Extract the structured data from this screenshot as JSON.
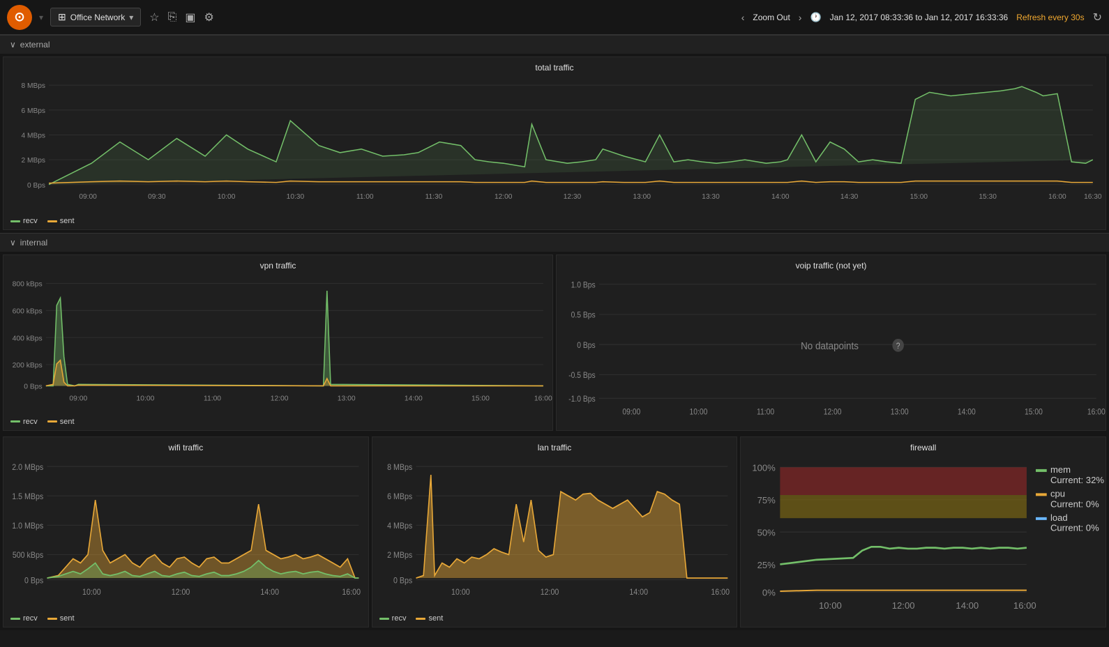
{
  "topnav": {
    "logo": "⊙",
    "title": "Office Network",
    "dropdown_arrow": "▾",
    "icons": [
      "☆",
      "⎘",
      "▣",
      "⚙"
    ],
    "zoom_out": "Zoom Out",
    "time_range": "Jan 12, 2017 08:33:36 to Jan 12, 2017 16:33:36",
    "refresh_label": "Refresh every 30s",
    "refresh_icon": "↻"
  },
  "sections": {
    "external": {
      "label": "external",
      "collapsed": false
    },
    "internal": {
      "label": "internal",
      "collapsed": false
    }
  },
  "panels": {
    "total_traffic": {
      "title": "total traffic",
      "y_labels": [
        "8 MBps",
        "6 MBps",
        "4 MBps",
        "2 MBps",
        "0 Bps"
      ],
      "x_labels": [
        "09:00",
        "09:30",
        "10:00",
        "10:30",
        "11:00",
        "11:30",
        "12:00",
        "12:30",
        "13:00",
        "13:30",
        "14:00",
        "14:30",
        "15:00",
        "15:30",
        "16:00",
        "16:30"
      ],
      "legend": [
        {
          "label": "recv",
          "color": "#73bf69"
        },
        {
          "label": "sent",
          "color": "#e8a838"
        }
      ]
    },
    "vpn_traffic": {
      "title": "vpn traffic",
      "y_labels": [
        "800 kBps",
        "600 kBps",
        "400 kBps",
        "200 kBps",
        "0 Bps"
      ],
      "x_labels": [
        "09:00",
        "10:00",
        "11:00",
        "12:00",
        "13:00",
        "14:00",
        "15:00",
        "16:00"
      ],
      "legend": [
        {
          "label": "recv",
          "color": "#73bf69"
        },
        {
          "label": "sent",
          "color": "#e8a838"
        }
      ]
    },
    "voip_traffic": {
      "title": "voip traffic (not yet)",
      "y_labels": [
        "1.0 Bps",
        "0.5 Bps",
        "0 Bps",
        "-0.5 Bps",
        "-1.0 Bps"
      ],
      "x_labels": [
        "09:00",
        "10:00",
        "11:00",
        "12:00",
        "13:00",
        "14:00",
        "15:00",
        "16:00"
      ],
      "no_data": "No datapoints"
    },
    "wifi_traffic": {
      "title": "wifi traffic",
      "y_labels": [
        "2.0 MBps",
        "1.5 MBps",
        "1.0 MBps",
        "500 kBps",
        "0 Bps"
      ],
      "x_labels": [
        "10:00",
        "12:00",
        "14:00",
        "16:00"
      ],
      "legend": [
        {
          "label": "recv",
          "color": "#73bf69"
        },
        {
          "label": "sent",
          "color": "#e8a838"
        }
      ]
    },
    "lan_traffic": {
      "title": "lan traffic",
      "y_labels": [
        "8 MBps",
        "6 MBps",
        "4 MBps",
        "2 MBps",
        "0 Bps"
      ],
      "x_labels": [
        "10:00",
        "12:00",
        "14:00",
        "16:00"
      ],
      "legend": [
        {
          "label": "recv",
          "color": "#73bf69"
        },
        {
          "label": "sent",
          "color": "#e8a838"
        }
      ]
    },
    "firewall": {
      "title": "firewall",
      "y_labels": [
        "100%",
        "75%",
        "50%",
        "25%",
        "0%"
      ],
      "x_labels": [
        "10:00",
        "12:00",
        "14:00",
        "16:00"
      ],
      "legend": [
        {
          "label": "mem",
          "color": "#73bf69",
          "current": "Current: 32%"
        },
        {
          "label": "cpu",
          "color": "#e8a838",
          "current": "Current: 0%"
        },
        {
          "label": "load",
          "color": "#6ab7ff",
          "current": "Current: 0%"
        }
      ]
    }
  }
}
